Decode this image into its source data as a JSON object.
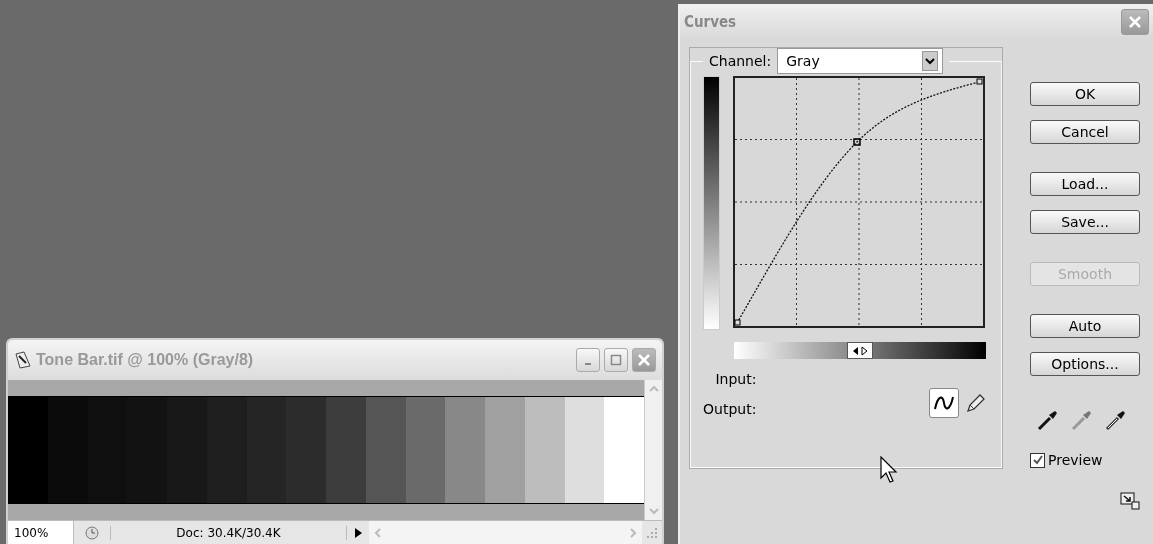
{
  "document_window": {
    "title": "Tone Bar.tif @ 100% (Gray/8)",
    "swatches": [
      {
        "color": "#000000"
      },
      {
        "color": "#0a0a0a"
      },
      {
        "color": "#0f0f0f"
      },
      {
        "color": "#121212"
      },
      {
        "color": "#181818"
      },
      {
        "color": "#1e1e1e"
      },
      {
        "color": "#252525"
      },
      {
        "color": "#2c2c2c"
      },
      {
        "color": "#3c3c3c"
      },
      {
        "color": "#555555"
      },
      {
        "color": "#6a6a6a"
      },
      {
        "color": "#888888"
      },
      {
        "color": "#a0a0a0"
      },
      {
        "color": "#bdbdbd"
      },
      {
        "color": "#dedede"
      },
      {
        "color": "#ffffff"
      }
    ],
    "status_bar": {
      "zoom": "100%",
      "doc_info": "Doc: 30.4K/30.4K"
    }
  },
  "curves_dialog": {
    "title": "Curves",
    "channel": {
      "label": "Channel:",
      "value": "Gray"
    },
    "input_label": "Input:",
    "output_label": "Output:",
    "tools": [
      {
        "kind": "curve",
        "selected": true
      },
      {
        "kind": "pencil",
        "selected": false
      }
    ],
    "buttons": [
      {
        "label": "OK",
        "disabled": false
      },
      {
        "label": "Cancel",
        "disabled": false
      },
      {
        "label": "Load...",
        "disabled": false
      },
      {
        "label": "Save...",
        "disabled": false
      },
      {
        "label": "Smooth",
        "disabled": true
      },
      {
        "label": "Auto",
        "disabled": false
      },
      {
        "label": "Options...",
        "disabled": false
      }
    ],
    "preview": {
      "label": "Preview",
      "checked": true
    }
  }
}
